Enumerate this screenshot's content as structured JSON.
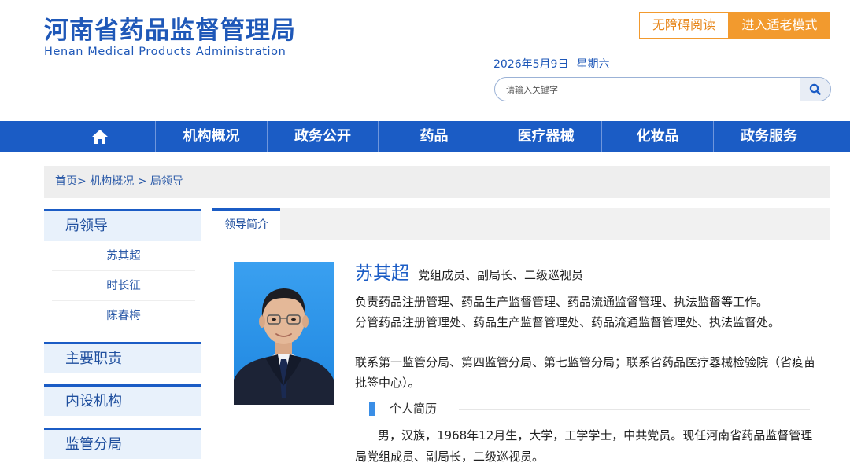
{
  "header": {
    "logo_cn": "河南省药品监督管理局",
    "logo_en": "Henan Medical Products Administration",
    "accessibility_label": "无障碍阅读",
    "elder_mode_label": "进入适老模式",
    "date": "2026年5月9日",
    "weekday": "星期六",
    "search_placeholder": "请输入关键字"
  },
  "nav": {
    "home_icon": "home-icon",
    "items": [
      "机构概况",
      "政务公开",
      "药品",
      "医疗器械",
      "化妆品",
      "政务服务"
    ]
  },
  "breadcrumb": {
    "items": [
      "首页",
      "机构概况",
      "局领导"
    ],
    "separator": ">"
  },
  "sidebar": {
    "sections": [
      {
        "label": "局领导",
        "children": [
          "苏其超",
          "时长征",
          "陈春梅"
        ]
      },
      {
        "label": "主要职责"
      },
      {
        "label": "内设机构"
      },
      {
        "label": "监管分局"
      }
    ]
  },
  "main": {
    "tab_label": "领导简介",
    "leader": {
      "name": "苏其超",
      "title": "党组成员、副局长、二级巡视员",
      "duties": [
        "负责药品注册管理、药品生产监督管理、药品流通监督管理、执法监督等工作。",
        "分管药品注册管理处、药品生产监督管理处、药品流通监督管理处、执法监督处。",
        "联系第一监管分局、第四监管分局、第七监管分局；联系省药品医疗器械检验院（省疫苗批签中心）。"
      ],
      "resume_heading": "个人简历",
      "resume_text": "男，汉族，1968年12月生，大学，工学学士，中共党员。现任河南省药品监督管理局党组成员、副局长，二级巡视员。"
    }
  },
  "colors": {
    "brand_blue": "#1b5cc5",
    "accent_orange": "#f29a2e"
  }
}
